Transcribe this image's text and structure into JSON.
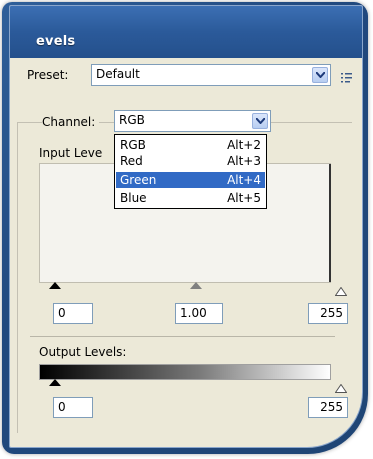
{
  "window": {
    "title": "evels"
  },
  "preset": {
    "label": "Preset:",
    "value": "Default"
  },
  "channel": {
    "label": "Channel:",
    "value": "RGB"
  },
  "input_levels": {
    "label": "Input Leve",
    "black": "0",
    "gamma": "1.00",
    "white": "255"
  },
  "output_levels": {
    "label": "Output Levels:",
    "black": "0",
    "white": "255"
  },
  "channel_menu": {
    "items": [
      {
        "name": "RGB",
        "shortcut": "Alt+2"
      },
      {
        "name": "Red",
        "shortcut": "Alt+3"
      },
      {
        "name": "Green",
        "shortcut": "Alt+4"
      },
      {
        "name": "Blue",
        "shortcut": "Alt+5"
      }
    ],
    "selected": "Green"
  },
  "colors": {
    "title_bar": "#2b5a9a",
    "frame_outer": "#21497f",
    "dialog_bg": "#ece9d8",
    "selection": "#316ac5"
  },
  "icons": [
    "chevron-down-icon",
    "preset-options-icon",
    "black-point-slider-icon",
    "gamma-slider-icon",
    "white-point-slider-icon"
  ]
}
